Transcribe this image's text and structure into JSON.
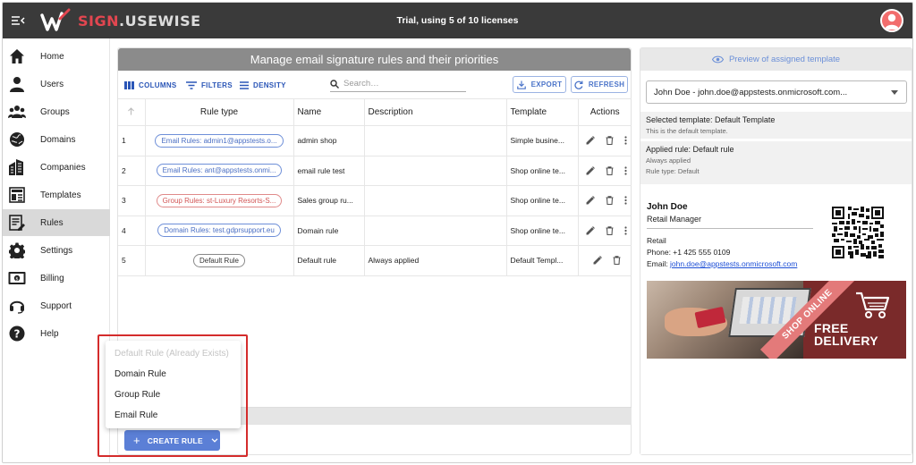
{
  "header": {
    "brand_primary": "SIGN",
    "brand_dot": ".",
    "brand_secondary": "USEWISE",
    "trial_text": "Trial, using 5 of 10 licenses"
  },
  "sidebar": {
    "items": [
      {
        "label": "Home",
        "icon": "home-icon"
      },
      {
        "label": "Users",
        "icon": "user-icon"
      },
      {
        "label": "Groups",
        "icon": "groups-icon"
      },
      {
        "label": "Domains",
        "icon": "globe-icon"
      },
      {
        "label": "Companies",
        "icon": "buildings-icon"
      },
      {
        "label": "Templates",
        "icon": "template-icon"
      },
      {
        "label": "Rules",
        "icon": "rules-icon"
      },
      {
        "label": "Settings",
        "icon": "gear-icon"
      },
      {
        "label": "Billing",
        "icon": "billing-icon"
      },
      {
        "label": "Support",
        "icon": "headset-icon"
      },
      {
        "label": "Help",
        "icon": "help-icon"
      }
    ],
    "active": "Rules"
  },
  "main": {
    "title": "Manage email signature rules and their priorities",
    "toolbar": {
      "columns": "COLUMNS",
      "filters": "FILTERS",
      "density": "DENSITY",
      "search_placeholder": "Search…",
      "export": "EXPORT",
      "refresh": "REFRESH"
    },
    "table": {
      "headers": [
        "",
        "Rule type",
        "Name",
        "Description",
        "Template",
        "Actions"
      ],
      "rows": [
        {
          "priority": "1",
          "rule_type": "Email Rules: admin1@appstests.o...",
          "kind": "email",
          "name": "admin shop",
          "description": "",
          "template": "Simple busine..."
        },
        {
          "priority": "2",
          "rule_type": "Email Rules: ant@appstests.onmi...",
          "kind": "email",
          "name": "email rule test",
          "description": "",
          "template": "Shop online te..."
        },
        {
          "priority": "3",
          "rule_type": "Group Rules: st-Luxury Resorts-S...",
          "kind": "group",
          "name": "Sales group ru...",
          "description": "",
          "template": "Shop online te..."
        },
        {
          "priority": "4",
          "rule_type": "Domain Rules: test.gdprsupport.eu",
          "kind": "domain",
          "name": "Domain rule",
          "description": "",
          "template": "Shop online te..."
        },
        {
          "priority": "5",
          "rule_type": "Default Rule",
          "kind": "default",
          "name": "Default rule",
          "description": "Always applied",
          "template": "Default Templ..."
        }
      ]
    },
    "create_button": "CREATE RULE",
    "menu": {
      "items": [
        {
          "label": "Default Rule (Already Exists)",
          "disabled": true
        },
        {
          "label": "Domain Rule",
          "disabled": false
        },
        {
          "label": "Group Rule",
          "disabled": false
        },
        {
          "label": "Email Rule",
          "disabled": false
        }
      ]
    }
  },
  "side": {
    "preview_label": "Preview of assigned template",
    "selected_user": "John Doe - john.doe@appstests.onmicrosoft.com...",
    "template_info": {
      "title": "Selected template: Default Template",
      "subtitle": "This is the default template."
    },
    "rule_info": {
      "title": "Applied rule: Default rule",
      "line1": "Always applied",
      "line2": "Rule type: Default"
    },
    "signature": {
      "name": "John Doe",
      "job_title": "Retail Manager",
      "department": "Retail",
      "phone": "Phone: +1 425 555 0109",
      "email_label": "Email: ",
      "email": "john.doe@appstests.onmicrosoft.com"
    },
    "banner": {
      "ribbon": "SHOP ONLINE",
      "free_line1": "FREE",
      "free_line2": "DELIVERY"
    }
  },
  "colors": {
    "topbar": "#3a3a3a",
    "brand_red": "#e34650",
    "accent_blue": "#5b7fd6",
    "highlight_red": "#d42c2c",
    "title_gray": "#8b8b8b"
  }
}
